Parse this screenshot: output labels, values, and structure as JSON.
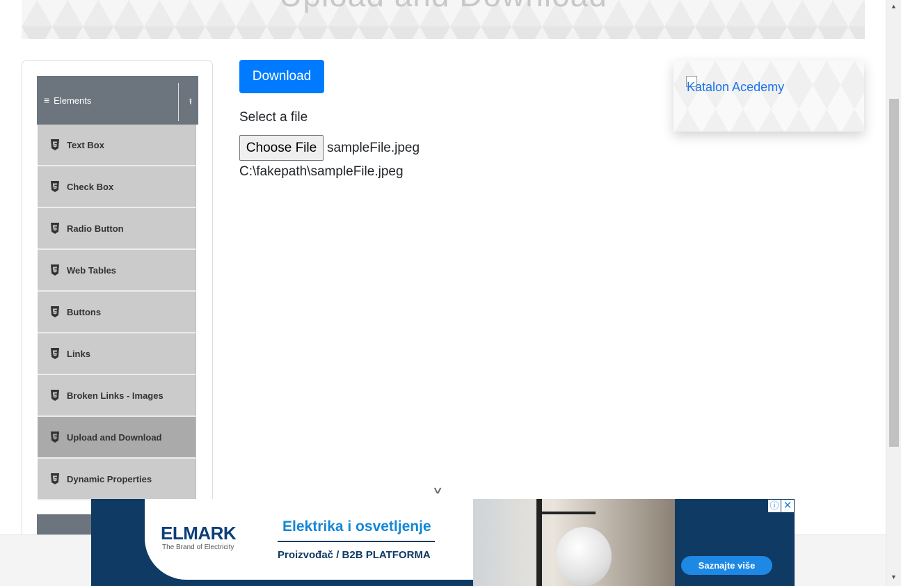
{
  "page": {
    "banner_title": "Upload and Download"
  },
  "sidebar": {
    "group_title": "Elements",
    "menu_icon": "hamburger-icon",
    "toggle_icon": "collapse-arrow-icon",
    "items": [
      {
        "label": "Text Box",
        "icon": "html5-icon",
        "active": false
      },
      {
        "label": "Check Box",
        "icon": "html5-icon",
        "active": false
      },
      {
        "label": "Radio Button",
        "icon": "html5-icon",
        "active": false
      },
      {
        "label": "Web Tables",
        "icon": "html5-icon",
        "active": false
      },
      {
        "label": "Buttons",
        "icon": "html5-icon",
        "active": false
      },
      {
        "label": "Links",
        "icon": "html5-icon",
        "active": false
      },
      {
        "label": "Broken Links - Images",
        "icon": "html5-icon",
        "active": false
      },
      {
        "label": "Upload and Download",
        "icon": "html5-icon",
        "active": true
      },
      {
        "label": "Dynamic Properties",
        "icon": "html5-icon",
        "active": false
      }
    ]
  },
  "main": {
    "download_label": "Download",
    "select_label": "Select a file",
    "choose_file_label": "Choose File",
    "selected_file": "sampleFile.jpeg",
    "uploaded_path": "C:\\fakepath\\sampleFile.jpeg"
  },
  "ad_card": {
    "link_text": "Katalon Acedemy"
  },
  "bottom_ad": {
    "brand": "ELMARK",
    "brand_sub": "The Brand of Electricity",
    "headline": "Elektrika i osvetljenje",
    "subline": "Proizvođač / B2B PLATFORMA",
    "cta": "Saznajte više",
    "info_icon": "ⓘ",
    "close_icon": "✕"
  },
  "colors": {
    "primary": "#007bff",
    "sidebar_header": "#6c757d",
    "menu_item": "#cbcbcb",
    "menu_item_active": "#aaaaaa",
    "ad_navy": "#0e3a63"
  }
}
